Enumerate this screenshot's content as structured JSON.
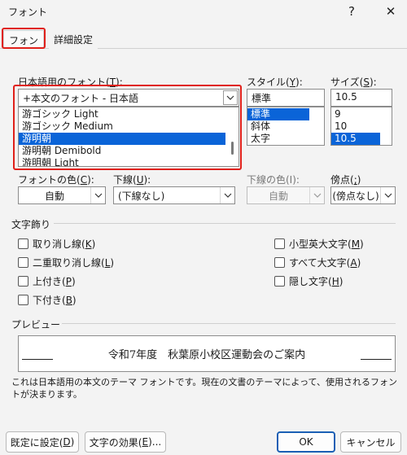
{
  "window": {
    "title": "フォント",
    "help": "?",
    "close": "✕"
  },
  "tabs": [
    {
      "label": "フォント",
      "active": true
    },
    {
      "label": "詳細設定",
      "active": false
    }
  ],
  "font": {
    "jp_label": "日本語用のフォント(",
    "jp_key": "T",
    "jp_label_end": "):",
    "jp_value": "+本文のフォント - 日本語",
    "jp_list": [
      "游ゴシック Light",
      "游ゴシック Medium",
      "游明朝",
      "游明朝 Demibold",
      "游明朝 Light"
    ],
    "jp_selected_index": 2,
    "style_label": "スタイル(",
    "style_key": "Y",
    "style_label_end": "):",
    "style_value": "標準",
    "style_list": [
      "標準",
      "斜体",
      "太字"
    ],
    "size_label": "サイズ(",
    "size_key": "S",
    "size_label_end": "):",
    "size_value": "10.5",
    "size_list": [
      "9",
      "10",
      "10.5"
    ],
    "color_label": "フォントの色(",
    "color_key": "C",
    "color_label_end": "):",
    "color_value": "自動",
    "underline_label": "下線(",
    "underline_key": "U",
    "underline_label_end": "):",
    "underline_value": "(下線なし)",
    "underline_color_label": "下線の色(I):",
    "underline_color_value": "自動",
    "emphasis_label": "傍点(",
    "emphasis_key": ";",
    "emphasis_label_end": ")",
    "emphasis_value": "(傍点なし)"
  },
  "effects": {
    "heading": "文字飾り",
    "left": [
      {
        "label": "取り消し線(",
        "key": "K",
        "end": ")"
      },
      {
        "label": "二重取り消し線(",
        "key": "L",
        "end": ")"
      },
      {
        "label": "上付き(",
        "key": "P",
        "end": ")"
      },
      {
        "label": "下付き(",
        "key": "B",
        "end": ")"
      }
    ],
    "right": [
      {
        "label": "小型英大文字(",
        "key": "M",
        "end": ")"
      },
      {
        "label": "すべて大文字(",
        "key": "A",
        "end": ")"
      },
      {
        "label": "隠し文字(",
        "key": "H",
        "end": ")"
      }
    ]
  },
  "preview": {
    "heading": "プレビュー",
    "sample": "令和7年度　秋葉原小校区運動会のご案内",
    "description": "これは日本語用の本文のテーマ フォントです。現在の文書のテーマによって、使用されるフォントが決まります。"
  },
  "buttons": {
    "default_label": "既定に設定(",
    "default_key": "D",
    "default_end": ")",
    "effects_label": "文字の効果(",
    "effects_key": "E",
    "effects_end": ")...",
    "ok": "OK",
    "cancel": "キャンセル"
  },
  "colors": {
    "highlight": "#e0201a",
    "selection": "#0a64d8",
    "primary_border": "#1a5fb4"
  }
}
